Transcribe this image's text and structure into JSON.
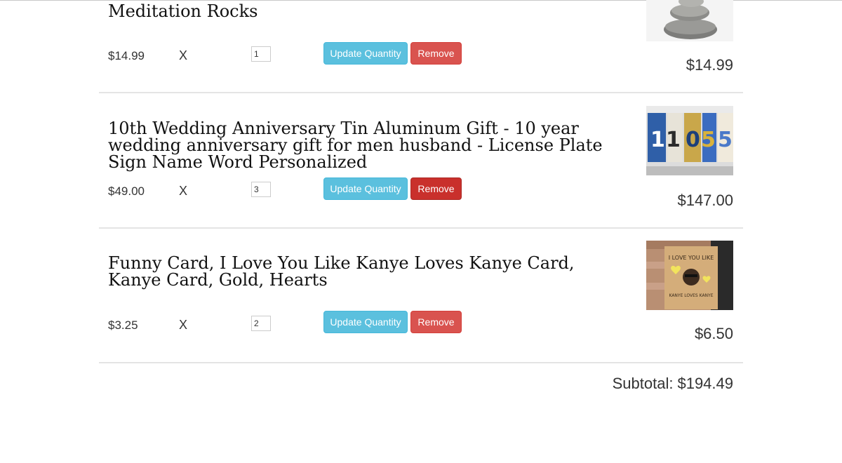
{
  "cart": {
    "items": [
      {
        "title": "Meditation Rocks",
        "unit_price": "$14.99",
        "times": "X",
        "quantity": "1",
        "update_label": "Update Quantity",
        "remove_label": "Remove",
        "line_total": "$14.99",
        "image": "stacked-stones-image"
      },
      {
        "title": "10th Wedding Anniversary Tin Aluminum Gift - 10 year wedding anniversary gift for men husband - License Plate Sign Name Word Personalized",
        "unit_price": "$49.00",
        "times": "X",
        "quantity": "3",
        "update_label": "Update Quantity",
        "remove_label": "Remove",
        "line_total": "$147.00",
        "image": "license-plate-sign-image"
      },
      {
        "title": "Funny Card, I Love You Like Kanye Loves Kanye Card, Kanye Card, Gold, Hearts",
        "unit_price": "$3.25",
        "times": "X",
        "quantity": "2",
        "update_label": "Update Quantity",
        "remove_label": "Remove",
        "line_total": "$6.50",
        "image": "kanye-card-image",
        "card_text_top": "I LOVE YOU LIKE",
        "card_text_bottom": "KANYE LOVES KANYE"
      }
    ],
    "subtotal_label": "Subtotal:",
    "subtotal_value": "$194.49"
  },
  "colors": {
    "update_button": "#5bc0de",
    "remove_button": "#d9534f",
    "remove_button_active": "#c9302c",
    "divider": "#e4e4e4"
  }
}
